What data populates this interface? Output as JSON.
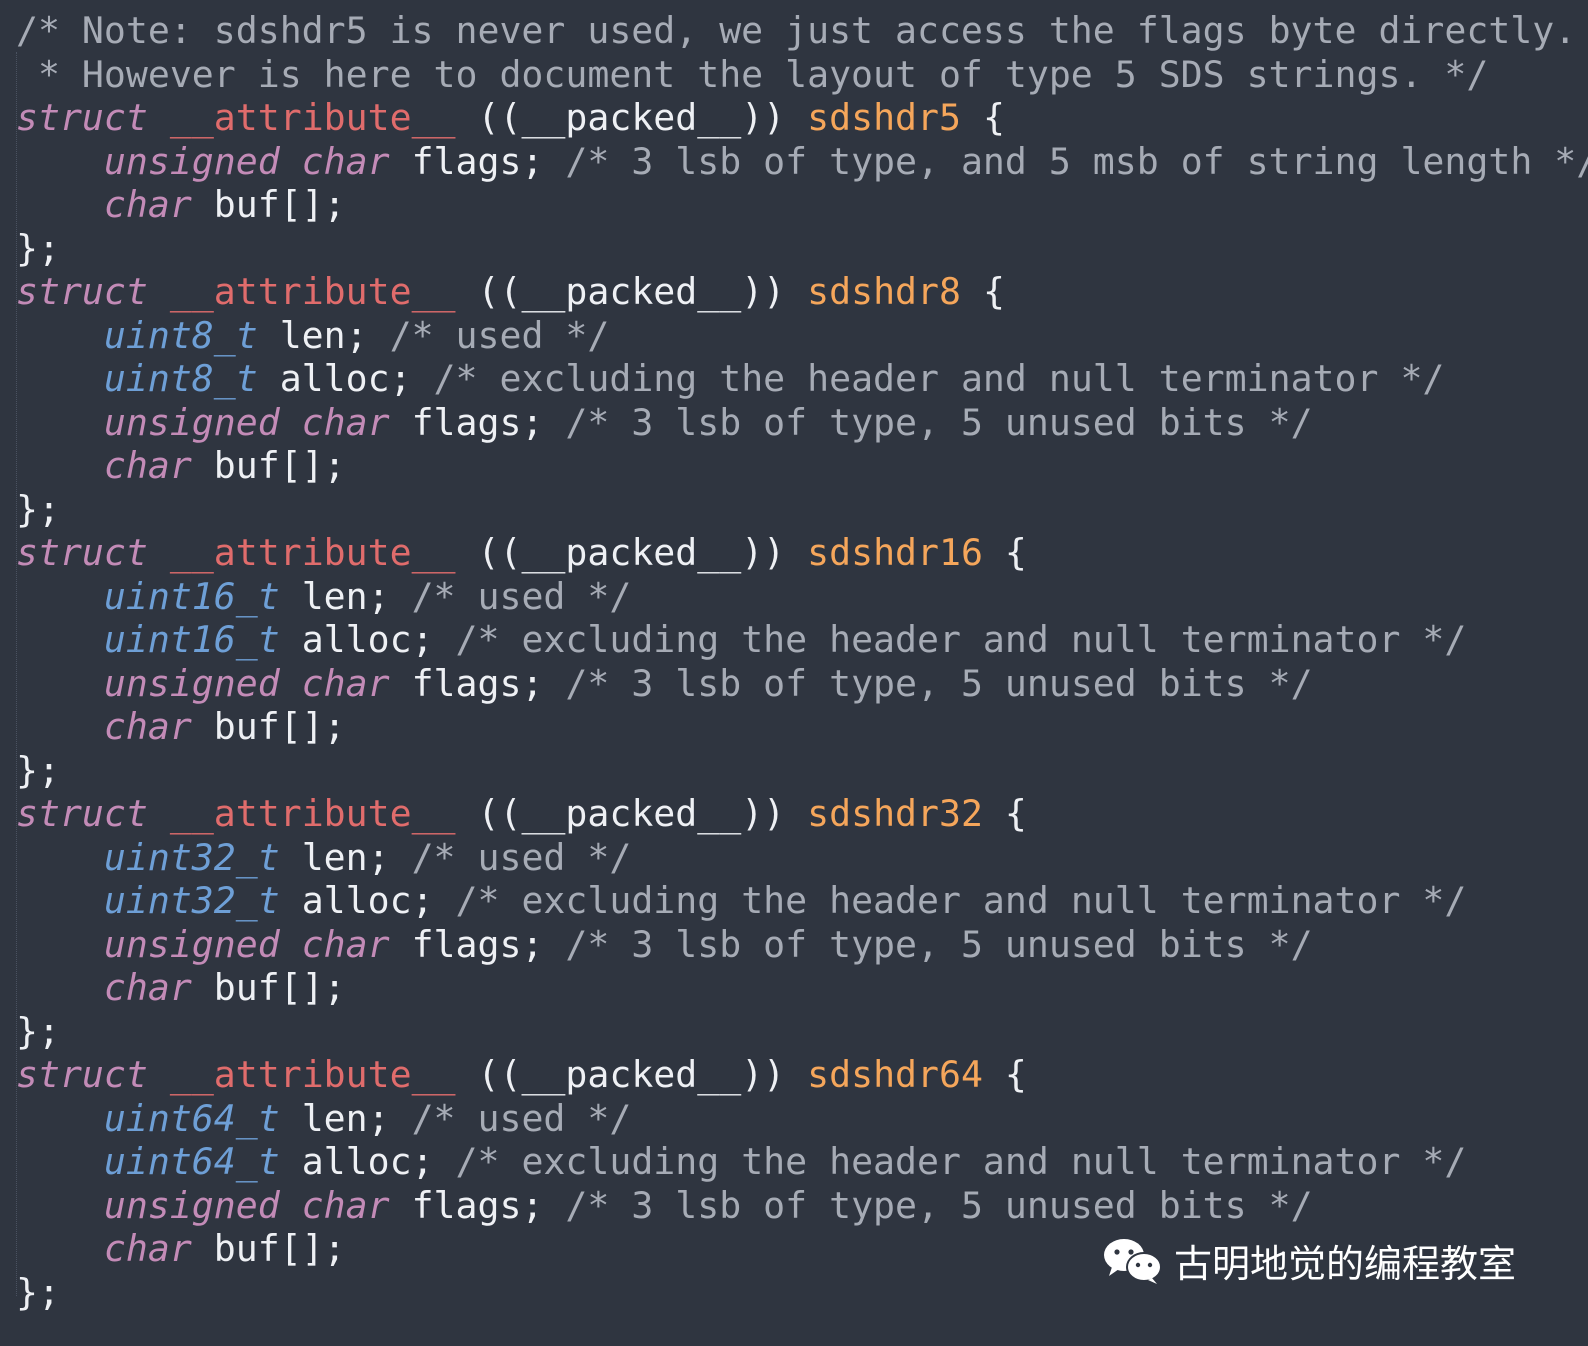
{
  "colors": {
    "background": "#2f3540",
    "comment": "#a6abb5",
    "keyword": "#c38bb7",
    "type": "#6e9fd6",
    "attribute": "#e06c6c",
    "struct_name": "#f5a65b",
    "plain": "#eef0f4"
  },
  "code_lines": [
    [
      {
        "t": "/* Note: sdshdr5 is never used, we just access the flags byte directly.",
        "c": "comment"
      }
    ],
    [
      {
        "t": " * However is here to document the layout of type 5 SDS strings. */",
        "c": "comment"
      }
    ],
    [
      {
        "t": "struct",
        "c": "keyword"
      },
      {
        "t": " ",
        "c": "plain"
      },
      {
        "t": "__attribute__",
        "c": "attr"
      },
      {
        "t": " ((__packed__)) ",
        "c": "plain"
      },
      {
        "t": "sdshdr5",
        "c": "name"
      },
      {
        "t": " {",
        "c": "plain"
      }
    ],
    [
      {
        "t": "    ",
        "c": "plain"
      },
      {
        "t": "unsigned char",
        "c": "type-kw"
      },
      {
        "t": " flags; ",
        "c": "plain"
      },
      {
        "t": "/* 3 lsb of type, and 5 msb of string length */",
        "c": "comment"
      }
    ],
    [
      {
        "t": "    ",
        "c": "plain"
      },
      {
        "t": "char",
        "c": "type-kw"
      },
      {
        "t": " buf[];",
        "c": "plain"
      }
    ],
    [
      {
        "t": "};",
        "c": "plain"
      }
    ],
    [
      {
        "t": "struct",
        "c": "keyword"
      },
      {
        "t": " ",
        "c": "plain"
      },
      {
        "t": "__attribute__",
        "c": "attr"
      },
      {
        "t": " ((__packed__)) ",
        "c": "plain"
      },
      {
        "t": "sdshdr8",
        "c": "name"
      },
      {
        "t": " {",
        "c": "plain"
      }
    ],
    [
      {
        "t": "    ",
        "c": "plain"
      },
      {
        "t": "uint8_t",
        "c": "type"
      },
      {
        "t": " len; ",
        "c": "plain"
      },
      {
        "t": "/* used */",
        "c": "comment"
      }
    ],
    [
      {
        "t": "    ",
        "c": "plain"
      },
      {
        "t": "uint8_t",
        "c": "type"
      },
      {
        "t": " alloc; ",
        "c": "plain"
      },
      {
        "t": "/* excluding the header and null terminator */",
        "c": "comment"
      }
    ],
    [
      {
        "t": "    ",
        "c": "plain"
      },
      {
        "t": "unsigned char",
        "c": "type-kw"
      },
      {
        "t": " flags; ",
        "c": "plain"
      },
      {
        "t": "/* 3 lsb of type, 5 unused bits */",
        "c": "comment"
      }
    ],
    [
      {
        "t": "    ",
        "c": "plain"
      },
      {
        "t": "char",
        "c": "type-kw"
      },
      {
        "t": " buf[];",
        "c": "plain"
      }
    ],
    [
      {
        "t": "};",
        "c": "plain"
      }
    ],
    [
      {
        "t": "struct",
        "c": "keyword"
      },
      {
        "t": " ",
        "c": "plain"
      },
      {
        "t": "__attribute__",
        "c": "attr"
      },
      {
        "t": " ((__packed__)) ",
        "c": "plain"
      },
      {
        "t": "sdshdr16",
        "c": "name"
      },
      {
        "t": " {",
        "c": "plain"
      }
    ],
    [
      {
        "t": "    ",
        "c": "plain"
      },
      {
        "t": "uint16_t",
        "c": "type"
      },
      {
        "t": " len; ",
        "c": "plain"
      },
      {
        "t": "/* used */",
        "c": "comment"
      }
    ],
    [
      {
        "t": "    ",
        "c": "plain"
      },
      {
        "t": "uint16_t",
        "c": "type"
      },
      {
        "t": " alloc; ",
        "c": "plain"
      },
      {
        "t": "/* excluding the header and null terminator */",
        "c": "comment"
      }
    ],
    [
      {
        "t": "    ",
        "c": "plain"
      },
      {
        "t": "unsigned char",
        "c": "type-kw"
      },
      {
        "t": " flags; ",
        "c": "plain"
      },
      {
        "t": "/* 3 lsb of type, 5 unused bits */",
        "c": "comment"
      }
    ],
    [
      {
        "t": "    ",
        "c": "plain"
      },
      {
        "t": "char",
        "c": "type-kw"
      },
      {
        "t": " buf[];",
        "c": "plain"
      }
    ],
    [
      {
        "t": "};",
        "c": "plain"
      }
    ],
    [
      {
        "t": "struct",
        "c": "keyword"
      },
      {
        "t": " ",
        "c": "plain"
      },
      {
        "t": "__attribute__",
        "c": "attr"
      },
      {
        "t": " ((__packed__)) ",
        "c": "plain"
      },
      {
        "t": "sdshdr32",
        "c": "name"
      },
      {
        "t": " {",
        "c": "plain"
      }
    ],
    [
      {
        "t": "    ",
        "c": "plain"
      },
      {
        "t": "uint32_t",
        "c": "type"
      },
      {
        "t": " len; ",
        "c": "plain"
      },
      {
        "t": "/* used */",
        "c": "comment"
      }
    ],
    [
      {
        "t": "    ",
        "c": "plain"
      },
      {
        "t": "uint32_t",
        "c": "type"
      },
      {
        "t": " alloc; ",
        "c": "plain"
      },
      {
        "t": "/* excluding the header and null terminator */",
        "c": "comment"
      }
    ],
    [
      {
        "t": "    ",
        "c": "plain"
      },
      {
        "t": "unsigned char",
        "c": "type-kw"
      },
      {
        "t": " flags; ",
        "c": "plain"
      },
      {
        "t": "/* 3 lsb of type, 5 unused bits */",
        "c": "comment"
      }
    ],
    [
      {
        "t": "    ",
        "c": "plain"
      },
      {
        "t": "char",
        "c": "type-kw"
      },
      {
        "t": " buf[];",
        "c": "plain"
      }
    ],
    [
      {
        "t": "};",
        "c": "plain"
      }
    ],
    [
      {
        "t": "struct",
        "c": "keyword"
      },
      {
        "t": " ",
        "c": "plain"
      },
      {
        "t": "__attribute__",
        "c": "attr"
      },
      {
        "t": " ((__packed__)) ",
        "c": "plain"
      },
      {
        "t": "sdshdr64",
        "c": "name"
      },
      {
        "t": " {",
        "c": "plain"
      }
    ],
    [
      {
        "t": "    ",
        "c": "plain"
      },
      {
        "t": "uint64_t",
        "c": "type"
      },
      {
        "t": " len; ",
        "c": "plain"
      },
      {
        "t": "/* used */",
        "c": "comment"
      }
    ],
    [
      {
        "t": "    ",
        "c": "plain"
      },
      {
        "t": "uint64_t",
        "c": "type"
      },
      {
        "t": " alloc; ",
        "c": "plain"
      },
      {
        "t": "/* excluding the header and null terminator */",
        "c": "comment"
      }
    ],
    [
      {
        "t": "    ",
        "c": "plain"
      },
      {
        "t": "unsigned char",
        "c": "type-kw"
      },
      {
        "t": " flags; ",
        "c": "plain"
      },
      {
        "t": "/* 3 lsb of type, 5 unused bits */",
        "c": "comment"
      }
    ],
    [
      {
        "t": "    ",
        "c": "plain"
      },
      {
        "t": "char",
        "c": "type-kw"
      },
      {
        "t": " buf[];",
        "c": "plain"
      }
    ],
    [
      {
        "t": "};",
        "c": "plain"
      }
    ]
  ],
  "watermark": {
    "icon": "wechat-icon",
    "text": "古明地觉的编程教室"
  }
}
